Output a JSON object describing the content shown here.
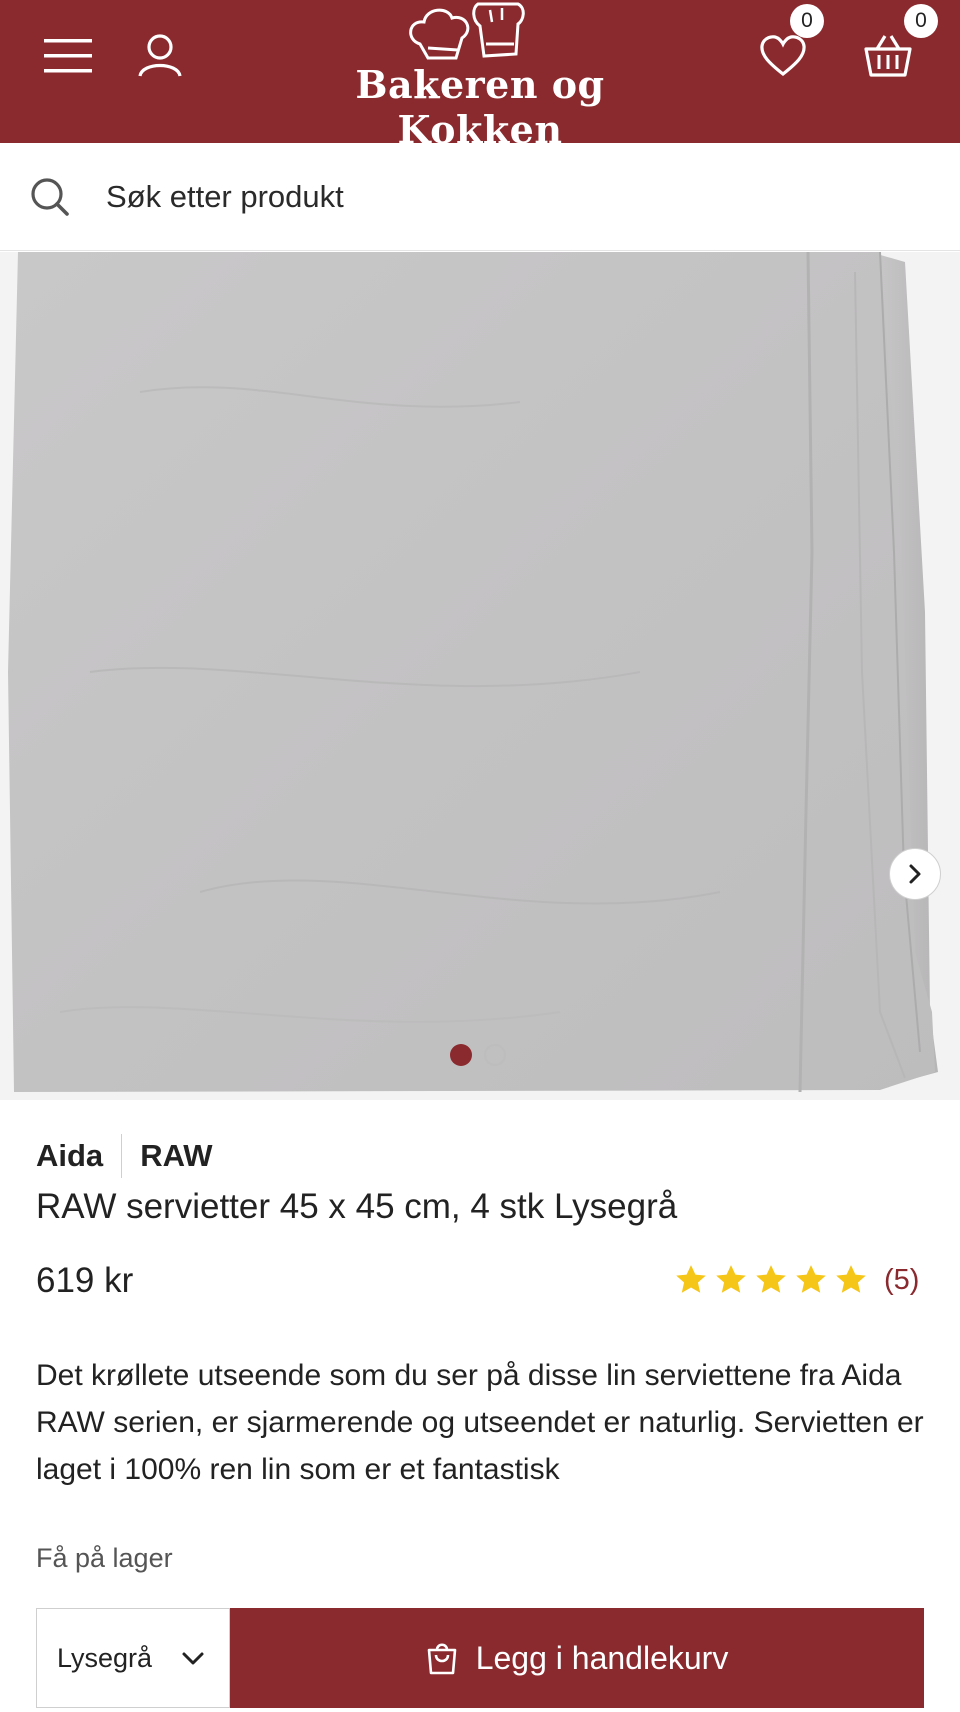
{
  "header": {
    "logo_text": "Bakeren og Kokken",
    "wishlist_count": "0",
    "cart_count": "0",
    "background": "#8b2a2e"
  },
  "search": {
    "placeholder": "Søk etter produkt"
  },
  "gallery": {
    "slide_count": 2,
    "active_slide": 1
  },
  "product": {
    "brand": "Aida",
    "series": "RAW",
    "title": "RAW servietter 45 x 45 cm, 4 stk Lysegrå",
    "price": "619 kr",
    "rating": 5,
    "review_count": "(5)",
    "description": "Det krøllete utseende som du ser på disse lin serviettene fra Aida RAW serien, er sjarmerende og utseendet er naturlig. Servietten er laget i 100% ren lin som er et fantastisk",
    "stock_status": "Få på lager",
    "selected_variant": "Lysegrå",
    "add_to_cart_label": "Legg i handlekurv"
  },
  "icons": {
    "menu": "hamburger-icon",
    "user": "user-icon",
    "wishlist": "heart-icon",
    "cart": "basket-icon",
    "search": "search-icon",
    "next": "chevron-right-icon",
    "dropdown": "chevron-down-icon",
    "add_to_cart": "shopping-bag-icon"
  },
  "colors": {
    "brand": "#8b2a2e",
    "star": "#f5c518"
  }
}
